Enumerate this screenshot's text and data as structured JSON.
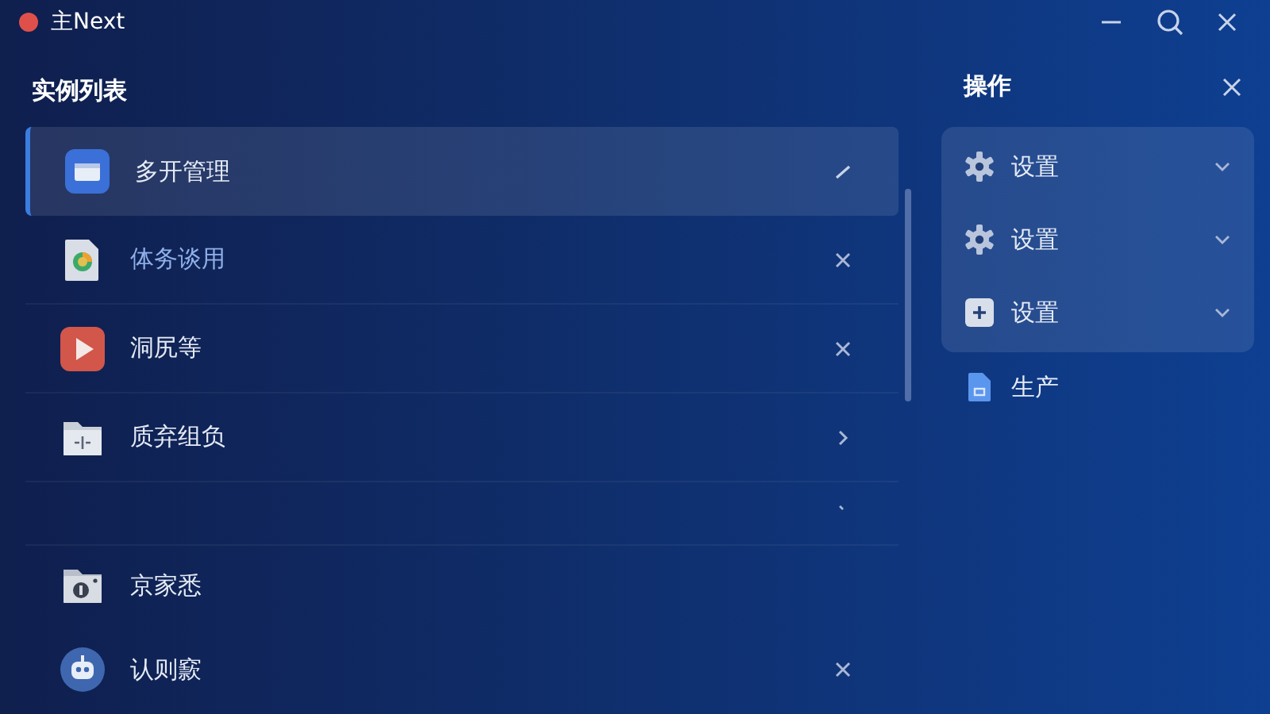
{
  "window": {
    "title": "主Next"
  },
  "list": {
    "title": "实例列表",
    "items": [
      {
        "label": "多开管理",
        "selected": true
      },
      {
        "label": "体务谈用",
        "selected": false
      },
      {
        "label": "洞尻等",
        "selected": false
      },
      {
        "label": "质弃组负",
        "selected": false
      },
      {
        "selected": false
      },
      {
        "label": "京家悉",
        "selected": false
      },
      {
        "label": "认则窾",
        "selected": false
      }
    ]
  },
  "actions": {
    "title": "操作",
    "groups": [
      {
        "label": "设置",
        "expanded": false
      },
      {
        "label": "设置",
        "expanded": false
      },
      {
        "label": "设置",
        "expanded": false
      }
    ],
    "items": [
      {
        "label": "生产"
      }
    ]
  }
}
